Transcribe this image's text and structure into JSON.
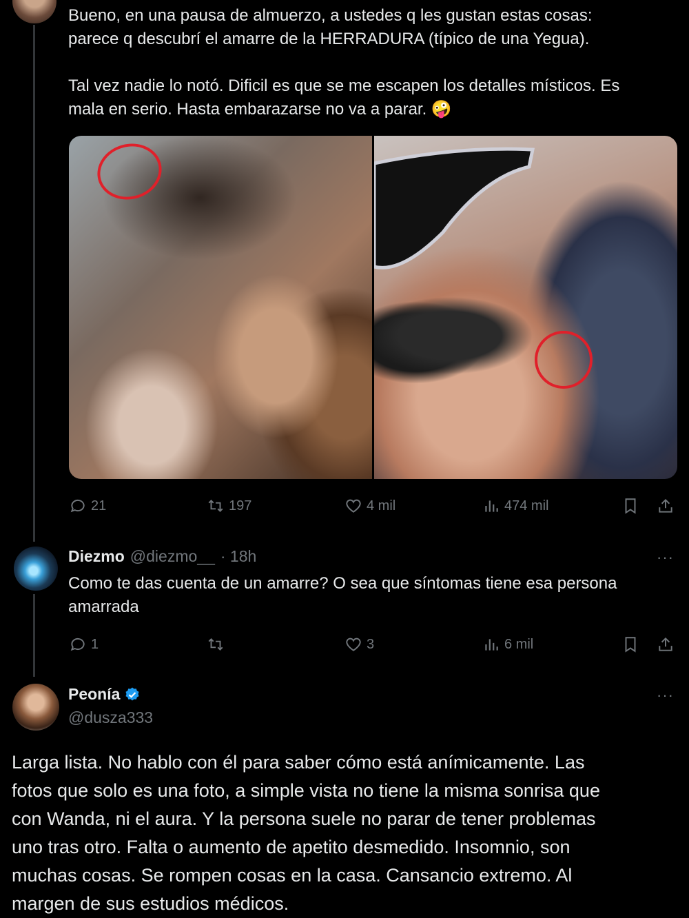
{
  "tweet1": {
    "text": "Bueno, en una pausa de almuerzo, a ustedes q les gustan estas cosas:\nparece q descubrí el amarre de la HERRADURA (típico de una Yegua).\n\nTal vez nadie lo notó. Dificil es que se me escapen los detalles místicos. Es\nmala en serio. Hasta embarazarse no va a parar. 🤪",
    "actions": {
      "replies": "21",
      "retweets": "197",
      "likes": "4 mil",
      "views": "474 mil"
    }
  },
  "reply": {
    "name": "Diezmo",
    "handle": "@diezmo__",
    "time": "· 18h",
    "more": "···",
    "text": "Como te das cuenta de un amarre? O sea que síntomas tiene esa persona\namarrada",
    "actions": {
      "replies": "1",
      "retweets": "",
      "likes": "3",
      "views": "6 mil"
    }
  },
  "main": {
    "name": "Peonía",
    "handle": "@dusza333",
    "more": "···",
    "text": "Larga lista. No hablo con él para saber cómo está anímicamente. Las\nfotos que solo es una foto, a simple vista no tiene la misma sonrisa que\ncon Wanda, ni el aura. Y la persona suele no parar de tener problemas\nuno tras otro. Falta o aumento de apetito desmedido. Insomnio, son\nmuchas cosas. Se rompen cosas en la casa. Cansancio extremo. Al\nmargen de sus estudios médicos."
  },
  "icons": {
    "reply": "speech-bubble-icon",
    "retweet": "retweet-icon",
    "like": "heart-icon",
    "views": "bar-chart-icon",
    "bookmark": "bookmark-icon",
    "share": "share-icon",
    "verified": "verified-badge-icon"
  },
  "colors": {
    "verified": "#1d9bf0",
    "muted": "#71767b",
    "circle_annotation": "#e0202a"
  }
}
